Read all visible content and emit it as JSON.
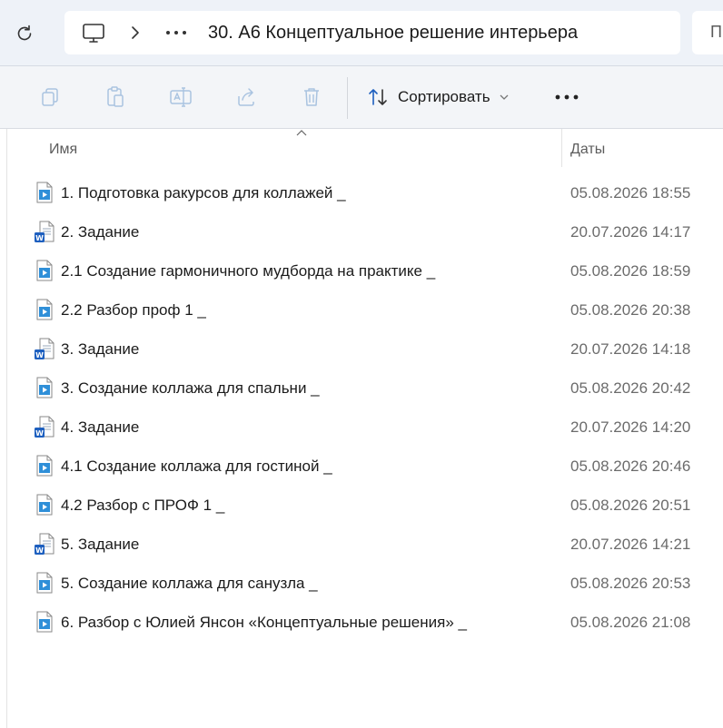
{
  "address_bar": {
    "breadcrumb_title": "30. А6 Концептуальное решение интерьера",
    "search_prefix": "П"
  },
  "toolbar": {
    "sort_label": "Сортировать"
  },
  "columns": {
    "name": "Имя",
    "date": "Даты"
  },
  "files": [
    {
      "name": "1. Подготовка ракурсов для коллажей _",
      "date": "05.08.2026 18:55",
      "type": "video"
    },
    {
      "name": "2. Задание",
      "date": "20.07.2026 14:17",
      "type": "word"
    },
    {
      "name": "2.1 Создание гармоничного мудборда на практике _",
      "date": "05.08.2026 18:59",
      "type": "video"
    },
    {
      "name": "2.2 Разбор проф 1 _",
      "date": "05.08.2026 20:38",
      "type": "video"
    },
    {
      "name": "3. Задание",
      "date": "20.07.2026 14:18",
      "type": "word"
    },
    {
      "name": "3. Создание коллажа для спальни _",
      "date": "05.08.2026 20:42",
      "type": "video"
    },
    {
      "name": "4. Задание",
      "date": "20.07.2026 14:20",
      "type": "word"
    },
    {
      "name": "4.1 Создание коллажа для гостиной _",
      "date": "05.08.2026 20:46",
      "type": "video"
    },
    {
      "name": "4.2 Разбор с ПРОФ 1 _",
      "date": "05.08.2026 20:51",
      "type": "video"
    },
    {
      "name": "5. Задание",
      "date": "20.07.2026 14:21",
      "type": "word"
    },
    {
      "name": "5. Создание коллажа для санузла _",
      "date": "05.08.2026 20:53",
      "type": "video"
    },
    {
      "name": "6. Разбор с Юлией Янсон «Концептуальные решения» _",
      "date": "05.08.2026 21:08",
      "type": "video"
    }
  ],
  "colors": {
    "accent": "#1a73c8",
    "word_blue": "#1d5fbf",
    "video_blue": "#2f8fd8",
    "disabled_icon": "#a9c3e0"
  }
}
